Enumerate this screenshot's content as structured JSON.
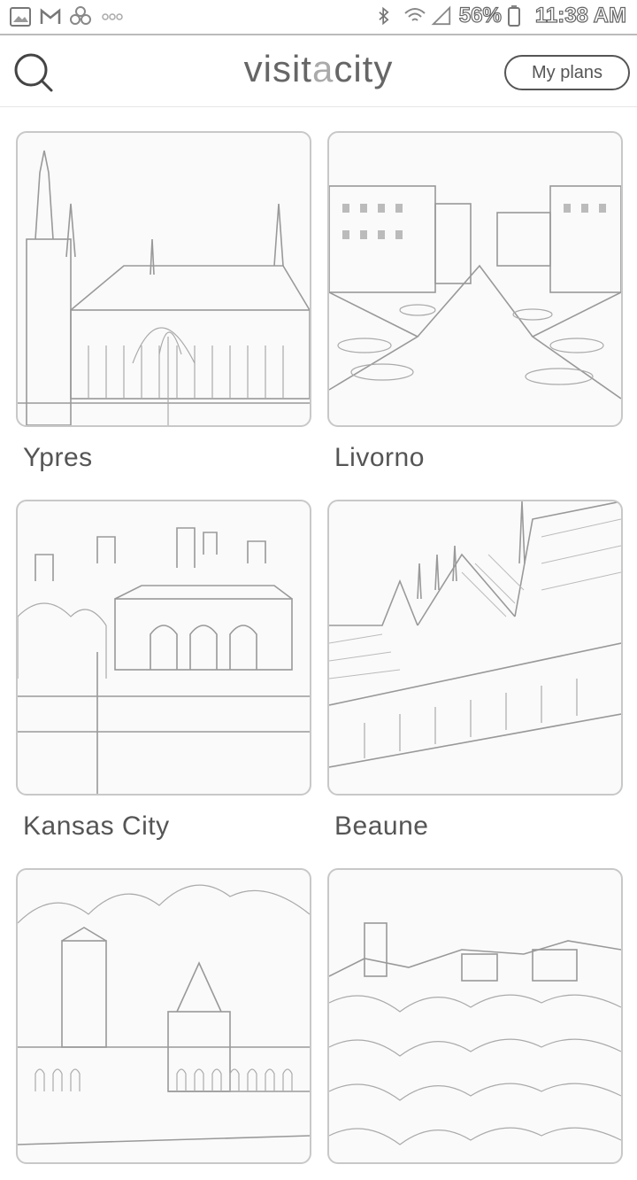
{
  "status_bar": {
    "battery": "56%",
    "time": "11:38 AM",
    "left_icons": [
      "gallery-icon",
      "gmail-icon",
      "pinwheel-icon",
      "more-dots-icon"
    ],
    "right_icons": [
      "bluetooth-icon",
      "wifi-icon",
      "signal-icon",
      "battery-icon"
    ]
  },
  "header": {
    "brand_prefix": "visit",
    "brand_accent": "a",
    "brand_suffix": "city",
    "plans_label": "My plans",
    "search_icon": "search-icon"
  },
  "cities": [
    {
      "name": "Ypres",
      "scene": "gothic-hall"
    },
    {
      "name": "Livorno",
      "scene": "canal"
    },
    {
      "name": "Kansas City",
      "scene": "station-skyline"
    },
    {
      "name": "Beaune",
      "scene": "tiled-roof-courtyard"
    },
    {
      "name": "",
      "scene": "tower-arcade"
    },
    {
      "name": "",
      "scene": "hill-town"
    }
  ]
}
